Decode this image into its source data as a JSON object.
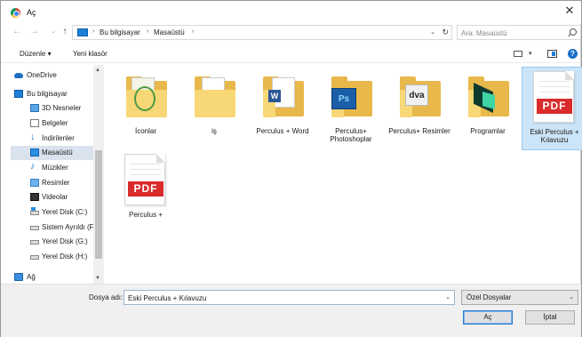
{
  "window": {
    "title": "Aç"
  },
  "address": {
    "crumbs": [
      "Bu bilgisayar",
      "Masaüstü"
    ],
    "search_placeholder": "Ara: Masaüstü"
  },
  "toolbar": {
    "organize": "Düzenle",
    "organize_dd": "▾",
    "new_folder": "Yeni klasör"
  },
  "sidebar": {
    "items": [
      {
        "label": "OneDrive",
        "icon": "onedrive-icon"
      },
      {
        "label": "Bu bilgisayar",
        "icon": "computer-icon"
      },
      {
        "label": "3D Nesneler",
        "icon": "3d-objects-icon"
      },
      {
        "label": "Belgeler",
        "icon": "documents-icon"
      },
      {
        "label": "İndirilenler",
        "icon": "downloads-icon"
      },
      {
        "label": "Masaüstü",
        "icon": "desktop-icon"
      },
      {
        "label": "Müzikler",
        "icon": "music-icon"
      },
      {
        "label": "Resimler",
        "icon": "pictures-icon"
      },
      {
        "label": "Videolar",
        "icon": "videos-icon"
      },
      {
        "label": "Yerel Disk (C:)",
        "icon": "local-disk-c-icon"
      },
      {
        "label": "Sistem Ayrıldı (F",
        "icon": "drive-icon"
      },
      {
        "label": "Yerel Disk (G:)",
        "icon": "drive-icon"
      },
      {
        "label": "Yerel Disk (H:)",
        "icon": "drive-icon"
      },
      {
        "label": "Ağ",
        "icon": "network-icon"
      }
    ],
    "selected": "Masaüstü"
  },
  "files": [
    {
      "name": "İconlar",
      "kind": "folder"
    },
    {
      "name": "iş",
      "kind": "folder"
    },
    {
      "name": "Perculus + Word",
      "kind": "folder"
    },
    {
      "name": "Perculus+ Photoshoplar",
      "kind": "folder"
    },
    {
      "name": "Perculus+ Resimler",
      "kind": "folder"
    },
    {
      "name": "Programlar",
      "kind": "folder"
    },
    {
      "name": "Eski Perculus + Kılavuzu",
      "kind": "pdf",
      "selected": true
    },
    {
      "name": "Perculus +",
      "kind": "pdf"
    }
  ],
  "badges": {
    "word": "W",
    "photoshop": "Ps",
    "image": "dva",
    "pdf": "PDF"
  },
  "bottom": {
    "filename_label": "Dosya adı:",
    "filename_value": "Eski Perculus + Kılavuzu",
    "filetype_value": "Özel Dosyalar",
    "open_label": "Aç",
    "cancel_label": "İptal"
  },
  "glyphs": {
    "close": "✕",
    "back": "←",
    "forward": "→",
    "recent_dd": "⌄",
    "up": "↑",
    "refresh": "↻",
    "chevron": "›",
    "dropdown": "⌄",
    "scroll_up": "▲",
    "scroll_down": "▼",
    "help": "?",
    "view_dd": "▾"
  },
  "colors": {
    "accent": "#1e7fd6",
    "selection": "#cce4f7",
    "folder": "#f8d776",
    "pdf": "#d92b2b"
  }
}
